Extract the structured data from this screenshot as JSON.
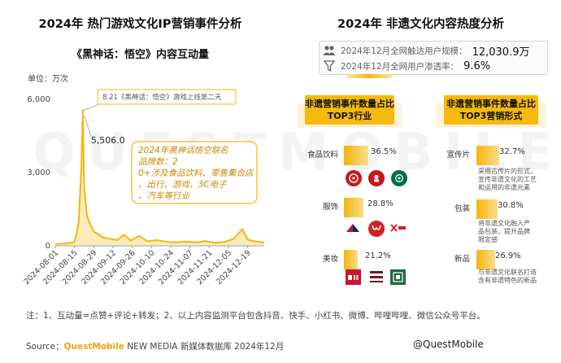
{
  "left": {
    "title": "2024年 热门游戏文化IP营销事件分析",
    "subtitle": "《黑神话：悟空》内容互动量",
    "unit": "单位：万次"
  },
  "right": {
    "title": "2024年 非遗文化内容热度分析"
  },
  "watermark": "QUESTMOBILE",
  "chart_data": [
    {
      "type": "line",
      "title": "《黑神话：悟空》内容互动量",
      "ylabel": "单位：万次",
      "ylim": [
        0,
        6000
      ],
      "yticks": [
        "0",
        "3,000",
        "6,000"
      ],
      "xticks": [
        "2024-08-01",
        "2024-08-15",
        "2024-08-29",
        "2024-09-12",
        "2024-09-26",
        "2024-10-10",
        "2024-10-24",
        "2024-11-07",
        "2024-11-21",
        "2024-12-05",
        "2024-12-19"
      ],
      "series": [
        {
          "x": [
            "2024-08-01",
            "2024-08-08",
            "2024-08-15",
            "2024-08-18",
            "2024-08-20",
            "2024-08-21",
            "2024-08-22",
            "2024-08-24",
            "2024-08-26",
            "2024-08-29",
            "2024-09-01",
            "2024-09-05",
            "2024-09-10",
            "2024-09-15",
            "2024-09-20",
            "2024-09-25",
            "2024-10-01",
            "2024-10-07",
            "2024-10-14",
            "2024-10-21",
            "2024-10-28",
            "2024-11-04",
            "2024-11-11",
            "2024-11-18",
            "2024-11-25",
            "2024-12-02",
            "2024-12-09",
            "2024-12-15",
            "2024-12-19",
            "2024-12-24",
            "2024-12-31"
          ],
          "y": [
            40,
            60,
            120,
            900,
            3200,
            5506,
            2400,
            1200,
            900,
            550,
            450,
            300,
            250,
            200,
            420,
            180,
            380,
            150,
            200,
            130,
            110,
            140,
            100,
            160,
            90,
            120,
            260,
            650,
            220,
            150,
            100
          ]
        }
      ],
      "annotations": {
        "peak_value": "5,506.0",
        "callout": "8.21《黑神话：悟空》游戏上线第二天",
        "box_text": "2024年黑神话悟空联名品牌数：20+ 涉及食品饮料、零售集合店、出行、游戏、3C电子、汽车等行业"
      }
    },
    {
      "type": "bar",
      "title": "非遗营销事件数量占比TOP3行业",
      "categories": [
        "食品饮料",
        "服饰",
        "美妆"
      ],
      "values": [
        36.5,
        28.8,
        21.2
      ],
      "labels": [
        "36.5%",
        "28.8%",
        "21.2%"
      ]
    },
    {
      "type": "bar",
      "title": "非遗营销事件数量占比TOP3营销形式",
      "categories": [
        "宣传片",
        "包装",
        "新品"
      ],
      "values": [
        32.7,
        30.8,
        26.9
      ],
      "labels": [
        "32.7%",
        "30.8%",
        "26.9%"
      ],
      "notes": [
        "采用古传片的形式，宣传非遗文化的工艺和运用的非遗元素",
        "将非遗文化融入产品包装，提升品牌限定感",
        "与非遗文化联名打造含有非遗特色的新品"
      ]
    }
  ],
  "stats": {
    "row1_label": "2024年12月全网触达用户规模：",
    "row1_value": "12,030.9万",
    "row2_label": "2024年12月全网用户渗透率：",
    "row2_value": "9.6%"
  },
  "panels": {
    "industry_header_1": "非遗营销事件数量占比",
    "industry_header_2": "TOP3行业",
    "form_header_1": "非遗营销事件数量占比",
    "form_header_2": "TOP3营销形式"
  },
  "logos": {
    "food": [
      "茅台",
      "KFC",
      "星巴克"
    ],
    "apparel": [
      "FILA",
      "lululemon",
      "X"
    ],
    "beauty": [
      "SK-II",
      "KANS",
      "百雀羚"
    ]
  },
  "footnote": "注：1、互动量=点赞+评论+转发；2、以上内容监测平台包含抖音、快手、小红书、微博、哔哩哔哩、微信公众号平台。",
  "source": {
    "prefix": "Source：",
    "brand": "QuestMobile",
    "rest": " NEW MEDIA 新媒体数据库 2024年12月"
  },
  "brand_mark": "@QuestMobile",
  "colors": {
    "accent": "#f6b90e",
    "line": "#f2b70f",
    "text": "#222222"
  }
}
